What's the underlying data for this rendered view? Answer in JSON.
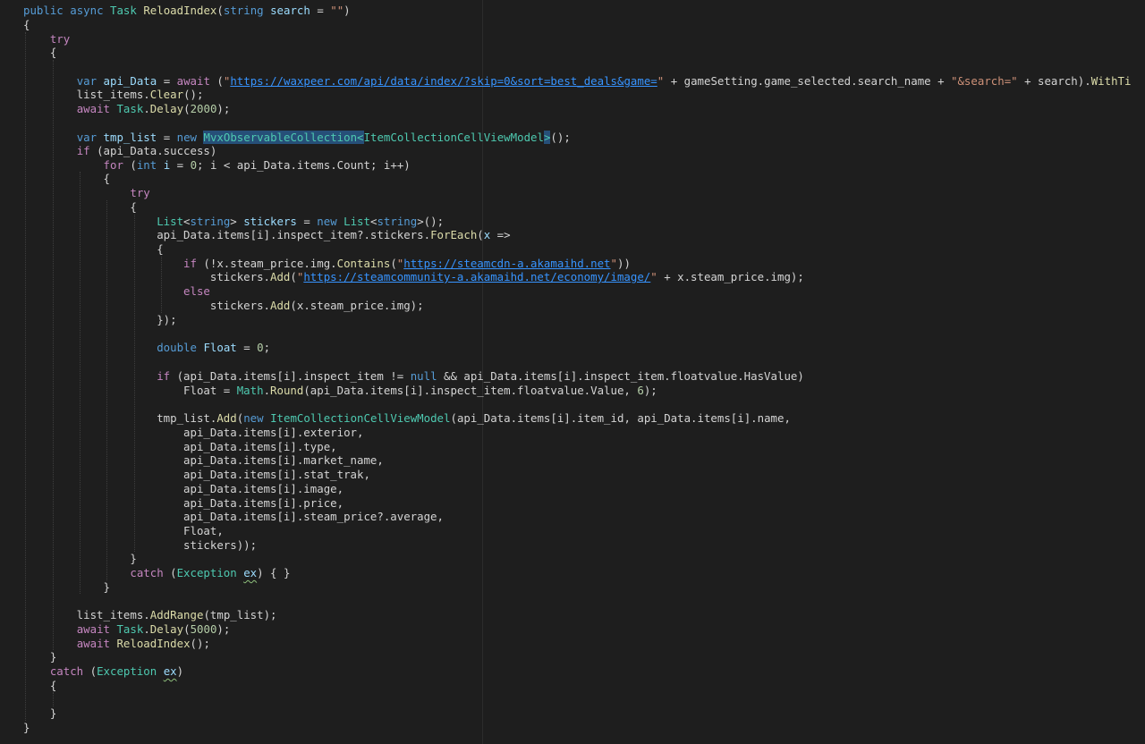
{
  "editor": {
    "theme_colors": {
      "background": "#1e1e1e",
      "keyword": "#569cd6",
      "control": "#c586c0",
      "type": "#4ec9b0",
      "function": "#dcdcaa",
      "variable": "#9cdcfe",
      "string": "#ce9178",
      "number": "#b5cea8",
      "link": "#3794ff",
      "selection": "#264f78"
    },
    "lines": [
      {
        "t": 4,
        "tokens": [
          [
            "kw",
            "public"
          ],
          [
            "pl",
            " "
          ],
          [
            "kw",
            "async"
          ],
          [
            "pl",
            " "
          ],
          [
            "ty",
            "Task"
          ],
          [
            "pl",
            " "
          ],
          [
            "fn",
            "ReloadIndex"
          ],
          [
            "pl",
            "("
          ],
          [
            "kw",
            "string"
          ],
          [
            "pl",
            " "
          ],
          [
            "var",
            "search"
          ],
          [
            "pl",
            " = "
          ],
          [
            "str",
            "\"\""
          ],
          [
            "pl",
            ")"
          ]
        ]
      },
      {
        "t": 20,
        "tokens": [
          [
            "pl",
            "{"
          ]
        ]
      },
      {
        "t": 36,
        "tokens": [
          [
            "pl",
            "    "
          ],
          [
            "ctl",
            "try"
          ]
        ]
      },
      {
        "t": 51,
        "tokens": [
          [
            "pl",
            "    {"
          ]
        ]
      },
      {
        "t": 83,
        "tokens": [
          [
            "pl",
            "        "
          ],
          [
            "kw",
            "var"
          ],
          [
            "pl",
            " "
          ],
          [
            "var",
            "api_Data"
          ],
          [
            "pl",
            " = "
          ],
          [
            "ctl",
            "await"
          ],
          [
            "pl",
            " ("
          ],
          [
            "str",
            "\""
          ],
          [
            "url",
            "https://waxpeer.com/api/data/index/?skip=0&sort=best_deals&game="
          ],
          [
            "str",
            "\""
          ],
          [
            "pl",
            " + gameSetting.game_selected.search_name + "
          ],
          [
            "str",
            "\"&search=\""
          ],
          [
            "pl",
            " + search)."
          ],
          [
            "fn",
            "WithTi"
          ]
        ]
      },
      {
        "t": 98,
        "tokens": [
          [
            "pl",
            "        list_items."
          ],
          [
            "fn",
            "Clear"
          ],
          [
            "pl",
            "();"
          ]
        ]
      },
      {
        "t": 114,
        "tokens": [
          [
            "pl",
            "        "
          ],
          [
            "ctl",
            "await"
          ],
          [
            "pl",
            " "
          ],
          [
            "ty",
            "Task"
          ],
          [
            "pl",
            "."
          ],
          [
            "fn",
            "Delay"
          ],
          [
            "pl",
            "("
          ],
          [
            "num",
            "2000"
          ],
          [
            "pl",
            ");"
          ]
        ]
      },
      {
        "t": 146,
        "tokens": [
          [
            "pl",
            "        "
          ],
          [
            "kw",
            "var"
          ],
          [
            "pl",
            " "
          ],
          [
            "var",
            "tmp_list"
          ],
          [
            "pl",
            " = "
          ],
          [
            "kw",
            "new"
          ],
          [
            "pl",
            " "
          ],
          [
            "hl",
            "MvxObservableCollection<"
          ],
          [
            "ty",
            "ItemCollectionCellViewModel"
          ],
          [
            "hl",
            ">"
          ],
          [
            "pl",
            "();"
          ]
        ]
      },
      {
        "t": 161,
        "tokens": [
          [
            "pl",
            "        "
          ],
          [
            "ctl",
            "if"
          ],
          [
            "pl",
            " (api_Data.success)"
          ]
        ]
      },
      {
        "t": 177,
        "tokens": [
          [
            "pl",
            "            "
          ],
          [
            "ctl",
            "for"
          ],
          [
            "pl",
            " ("
          ],
          [
            "kw",
            "int"
          ],
          [
            "pl",
            " "
          ],
          [
            "var",
            "i"
          ],
          [
            "pl",
            " = "
          ],
          [
            "num",
            "0"
          ],
          [
            "pl",
            "; i < api_Data.items.Count; i++)"
          ]
        ]
      },
      {
        "t": 192,
        "tokens": [
          [
            "pl",
            "            {"
          ]
        ]
      },
      {
        "t": 208,
        "tokens": [
          [
            "pl",
            "                "
          ],
          [
            "ctl",
            "try"
          ]
        ]
      },
      {
        "t": 224,
        "tokens": [
          [
            "pl",
            "                {"
          ]
        ]
      },
      {
        "t": 240,
        "tokens": [
          [
            "pl",
            "                    "
          ],
          [
            "ty",
            "List"
          ],
          [
            "pl",
            "<"
          ],
          [
            "kw",
            "string"
          ],
          [
            "pl",
            "> "
          ],
          [
            "var",
            "stickers"
          ],
          [
            "pl",
            " = "
          ],
          [
            "kw",
            "new"
          ],
          [
            "pl",
            " "
          ],
          [
            "ty",
            "List"
          ],
          [
            "pl",
            "<"
          ],
          [
            "kw",
            "string"
          ],
          [
            "pl",
            ">();"
          ]
        ]
      },
      {
        "t": 255,
        "tokens": [
          [
            "pl",
            "                    api_Data.items[i].inspect_item?.stickers."
          ],
          [
            "fn",
            "ForEach"
          ],
          [
            "pl",
            "("
          ],
          [
            "var",
            "x"
          ],
          [
            "pl",
            " =>"
          ]
        ]
      },
      {
        "t": 271,
        "tokens": [
          [
            "pl",
            "                    {"
          ]
        ]
      },
      {
        "t": 287,
        "tokens": [
          [
            "pl",
            "                        "
          ],
          [
            "ctl",
            "if"
          ],
          [
            "pl",
            " (!x.steam_price.img."
          ],
          [
            "fn",
            "Contains"
          ],
          [
            "pl",
            "("
          ],
          [
            "str",
            "\""
          ],
          [
            "url",
            "https://steamcdn-a.akamaihd.net"
          ],
          [
            "str",
            "\""
          ],
          [
            "pl",
            "))"
          ]
        ]
      },
      {
        "t": 302,
        "tokens": [
          [
            "pl",
            "                            stickers."
          ],
          [
            "fn",
            "Add"
          ],
          [
            "pl",
            "("
          ],
          [
            "str",
            "\""
          ],
          [
            "url",
            "https://steamcommunity-a.akamaihd.net/economy/image/"
          ],
          [
            "str",
            "\""
          ],
          [
            "pl",
            " + x.steam_price.img);"
          ]
        ]
      },
      {
        "t": 318,
        "tokens": [
          [
            "pl",
            "                        "
          ],
          [
            "ctl",
            "else"
          ]
        ]
      },
      {
        "t": 334,
        "tokens": [
          [
            "pl",
            "                            stickers."
          ],
          [
            "fn",
            "Add"
          ],
          [
            "pl",
            "(x.steam_price.img);"
          ]
        ]
      },
      {
        "t": 350,
        "tokens": [
          [
            "pl",
            "                    });"
          ]
        ]
      },
      {
        "t": 381,
        "tokens": [
          [
            "pl",
            "                    "
          ],
          [
            "kw",
            "double"
          ],
          [
            "pl",
            " "
          ],
          [
            "var",
            "Float"
          ],
          [
            "pl",
            " = "
          ],
          [
            "num",
            "0"
          ],
          [
            "pl",
            ";"
          ]
        ]
      },
      {
        "t": 413,
        "tokens": [
          [
            "pl",
            "                    "
          ],
          [
            "ctl",
            "if"
          ],
          [
            "pl",
            " (api_Data.items[i].inspect_item != "
          ],
          [
            "kw",
            "null"
          ],
          [
            "pl",
            " && api_Data.items[i].inspect_item.floatvalue.HasValue)"
          ]
        ]
      },
      {
        "t": 429,
        "tokens": [
          [
            "pl",
            "                        Float = "
          ],
          [
            "ty",
            "Math"
          ],
          [
            "pl",
            "."
          ],
          [
            "fn",
            "Round"
          ],
          [
            "pl",
            "(api_Data.items[i].inspect_item.floatvalue.Value, "
          ],
          [
            "num",
            "6"
          ],
          [
            "pl",
            ");"
          ]
        ]
      },
      {
        "t": 460,
        "tokens": [
          [
            "pl",
            "                    tmp_list."
          ],
          [
            "fn",
            "Add"
          ],
          [
            "pl",
            "("
          ],
          [
            "kw",
            "new"
          ],
          [
            "pl",
            " "
          ],
          [
            "ty",
            "ItemCollectionCellViewModel"
          ],
          [
            "pl",
            "(api_Data.items[i].item_id, api_Data.items[i].name,"
          ]
        ]
      },
      {
        "t": 476,
        "tokens": [
          [
            "pl",
            "                        api_Data.items[i].exterior,"
          ]
        ]
      },
      {
        "t": 492,
        "tokens": [
          [
            "pl",
            "                        api_Data.items[i].type,"
          ]
        ]
      },
      {
        "t": 507,
        "tokens": [
          [
            "pl",
            "                        api_Data.items[i].market_name,"
          ]
        ]
      },
      {
        "t": 523,
        "tokens": [
          [
            "pl",
            "                        api_Data.items[i].stat_trak,"
          ]
        ]
      },
      {
        "t": 539,
        "tokens": [
          [
            "pl",
            "                        api_Data.items[i].image,"
          ]
        ]
      },
      {
        "t": 555,
        "tokens": [
          [
            "pl",
            "                        api_Data.items[i].price,"
          ]
        ]
      },
      {
        "t": 570,
        "tokens": [
          [
            "pl",
            "                        api_Data.items[i].steam_price?.average,"
          ]
        ]
      },
      {
        "t": 586,
        "tokens": [
          [
            "pl",
            "                        Float,"
          ]
        ]
      },
      {
        "t": 602,
        "tokens": [
          [
            "pl",
            "                        stickers));"
          ]
        ]
      },
      {
        "t": 617,
        "tokens": [
          [
            "pl",
            "                }"
          ]
        ]
      },
      {
        "t": 633,
        "tokens": [
          [
            "pl",
            "                "
          ],
          [
            "ctl",
            "catch"
          ],
          [
            "pl",
            " ("
          ],
          [
            "ty",
            "Exception"
          ],
          [
            "pl",
            " "
          ],
          [
            "sq",
            "ex"
          ],
          [
            "pl",
            ") { }"
          ]
        ]
      },
      {
        "t": 649,
        "tokens": [
          [
            "pl",
            "            }"
          ]
        ]
      },
      {
        "t": 680,
        "tokens": [
          [
            "pl",
            "        list_items."
          ],
          [
            "fn",
            "AddRange"
          ],
          [
            "pl",
            "(tmp_list);"
          ]
        ]
      },
      {
        "t": 696,
        "tokens": [
          [
            "pl",
            "        "
          ],
          [
            "ctl",
            "await"
          ],
          [
            "pl",
            " "
          ],
          [
            "ty",
            "Task"
          ],
          [
            "pl",
            "."
          ],
          [
            "fn",
            "Delay"
          ],
          [
            "pl",
            "("
          ],
          [
            "num",
            "5000"
          ],
          [
            "pl",
            ");"
          ]
        ]
      },
      {
        "t": 712,
        "tokens": [
          [
            "pl",
            "        "
          ],
          [
            "ctl",
            "await"
          ],
          [
            "pl",
            " "
          ],
          [
            "fn",
            "ReloadIndex"
          ],
          [
            "pl",
            "();"
          ]
        ]
      },
      {
        "t": 727,
        "tokens": [
          [
            "pl",
            "    }"
          ]
        ]
      },
      {
        "t": 743,
        "tokens": [
          [
            "pl",
            "    "
          ],
          [
            "ctl",
            "catch"
          ],
          [
            "pl",
            " ("
          ],
          [
            "ty",
            "Exception"
          ],
          [
            "pl",
            " "
          ],
          [
            "sq",
            "ex"
          ],
          [
            "pl",
            ")"
          ]
        ]
      },
      {
        "t": 759,
        "tokens": [
          [
            "pl",
            "    {"
          ]
        ]
      },
      {
        "t": 790,
        "tokens": [
          [
            "pl",
            "    }"
          ]
        ]
      },
      {
        "t": 806,
        "tokens": [
          [
            "pl",
            "}"
          ]
        ]
      }
    ]
  }
}
